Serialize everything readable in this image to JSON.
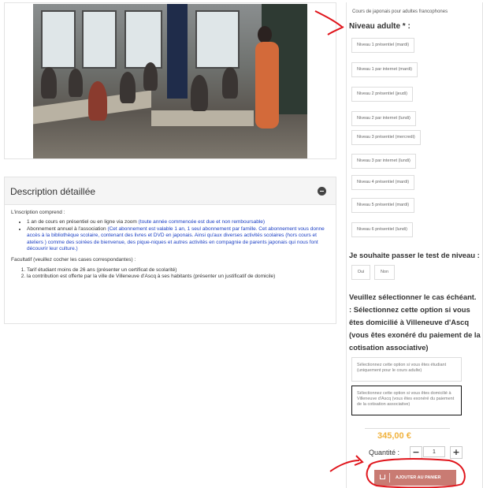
{
  "product": {
    "course_name": "Cours de japonais pour adultes francophones",
    "level_title": "Niveau adulte * :",
    "levels": [
      "Niveau 1 présentiel (mardi)",
      "Niveau 1 par internet (mardi)",
      "Niveau 2 présentiel (jeudi)",
      "Niveau 2 par internet (lundi)",
      "Niveau 3 présentiel (mercredi)",
      "Niveau 3 par internet (lundi)",
      "Niveau 4 présentiel (mardi)",
      "Niveau 5 présentiel (mardi)",
      "Niveau 6 présentiel (lundi)"
    ],
    "test_question": "Je souhaite passer le test de niveau :",
    "yes_label": "Oui",
    "no_label": "Non",
    "case_question": "Veuillez sélectionner le cas échéant. : Sélectionnez cette option si vous êtes domicilié à Villeneuve d'Ascq (vous êtes exonéré du paiement de la cotisation associative)",
    "case_lines": [
      "Veuillez sélectionner le cas échéant.",
      ": Sélectionnez cette option si vous",
      "êtes domicilié à Villeneuve d'Ascq",
      "(vous êtes exonéré du paiement de la",
      "cotisation associative)"
    ],
    "option_student": "Sélectionnez cette option si vous êtes étudiant (uniquement pour le cours adulte)",
    "option_resident": "Sélectionnez cette option si vous êtes domicilié à Villeneuve d'Ascq (vous êtes exonéré du paiement de la cotisation associative)",
    "price": "345,00 €",
    "quantity_label": "Quantité :",
    "quantity_value": "1",
    "minus": "−",
    "plus": "+",
    "add_to_cart": "AJOUTER AU PANIER"
  },
  "description": {
    "title": "Description détaillée",
    "intro": "L'inscription comprend :",
    "item1_plain": "1 an de cours en présentiel ou en ligne via zoom ",
    "item1_blue": "(toute année commencée est due et non remboursable)",
    "item2_plain": "Abonnement annuel à l'association ",
    "item2_blue": "(Cet abonnement est valable 1 an, 1 seul abonnement par famille.  Cet abonnement vous donne accès à la bibliothèque scolaire, contenant des livres et DVD en japonais.  Ainsi qu'aux diverses activités scolaires (hors cours et ateliers ) comme des soirées de bienvenue, des pique-niques et autres activités en compagnie de parents japonais qui nous font découvrir leur culture.)",
    "optional_intro": "Facultatif (veuillez cocher les cases correspondantes) :",
    "opt1": "Tarif étudiant moins de 26 ans (présenter un certificat de scolarité)",
    "opt2": "la contribution est offerte par la ville de Villeneuve d'Ascq à ses habitants (présenter un justificatif de domicile)"
  },
  "colors": {
    "price": "#f0b23d",
    "button": "#c97b73",
    "annotation": "#e0141b",
    "link_blue": "#1a3ec4"
  }
}
